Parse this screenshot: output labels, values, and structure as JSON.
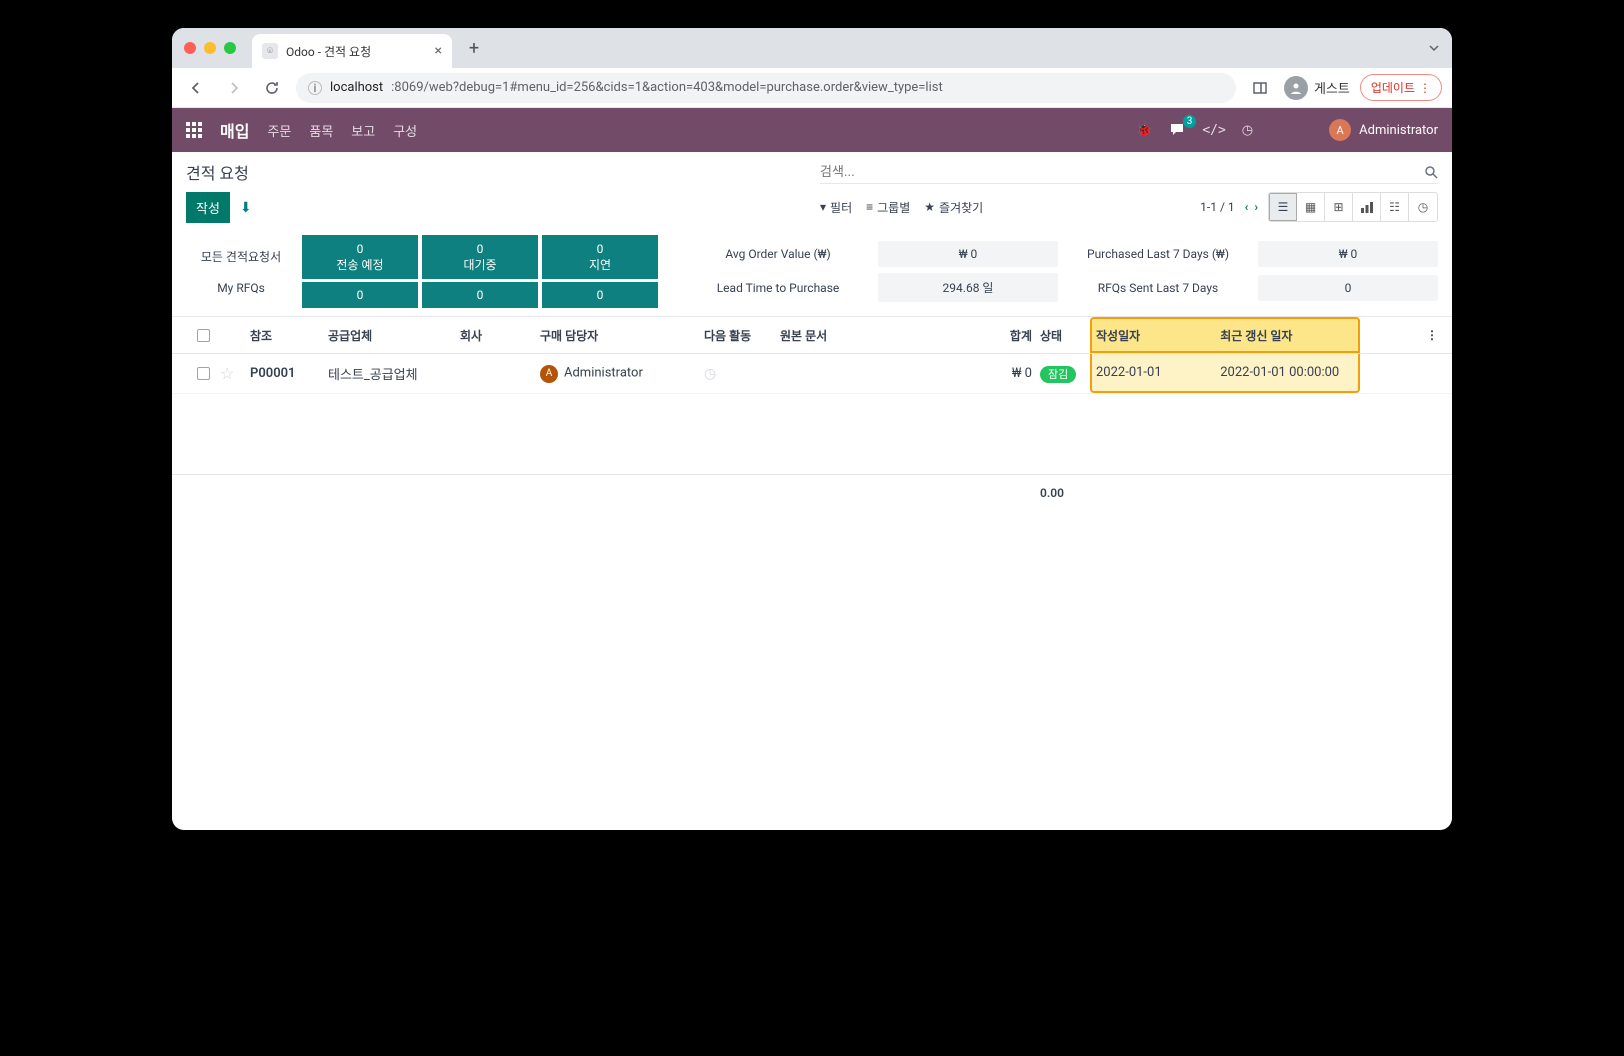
{
  "browser": {
    "tab_title": "Odoo - 견적 요청",
    "url_host": "localhost",
    "url_path": ":8069/web?debug=1#menu_id=256&cids=1&action=403&model=purchase.order&view_type=list",
    "guest_label": "게스트",
    "update_label": "업데이트"
  },
  "header": {
    "app": "매입",
    "nav": {
      "orders": "주문",
      "products": "품목",
      "reports": "보고",
      "config": "구성"
    },
    "badge": "3",
    "user": "Administrator",
    "user_initial": "A"
  },
  "control": {
    "breadcrumb": "견적 요청",
    "create": "작성",
    "search_ph": "검색...",
    "filter": "필터",
    "group": "그룹별",
    "fav": "즐겨찾기",
    "pager": "1-1 / 1"
  },
  "stats": {
    "all_rfq": "모든 견적요청서",
    "my_rfq": "My RFQs",
    "cols": [
      {
        "top": "0",
        "mid": "전송 예정",
        "bot": "0"
      },
      {
        "top": "0",
        "mid": "대기중",
        "bot": "0"
      },
      {
        "top": "0",
        "mid": "지연",
        "bot": "0"
      }
    ],
    "avg_label": "Avg Order Value (₩)",
    "avg_val": "₩ 0",
    "lead_label": "Lead Time to Purchase",
    "lead_val": "294.68 일",
    "purch_label": "Purchased Last 7 Days (₩)",
    "purch_val": "₩ 0",
    "sent_label": "RFQs Sent Last 7 Days",
    "sent_val": "0"
  },
  "table": {
    "h": {
      "ref": "참조",
      "vendor": "공급업체",
      "company": "회사",
      "rep": "구매 담당자",
      "act": "다음 활동",
      "src": "원본 문서",
      "total": "합계",
      "state": "상태",
      "create": "작성일자",
      "write": "최근 갱신 일자"
    },
    "rows": [
      {
        "ref": "P00001",
        "vendor": "테스트_공급업체",
        "company": "",
        "rep": "Administrator",
        "total": "₩ 0",
        "state": "잠김",
        "create": "2022-01-01",
        "write": "2022-01-01 00:00:00"
      }
    ],
    "footer_total": "0.00"
  }
}
